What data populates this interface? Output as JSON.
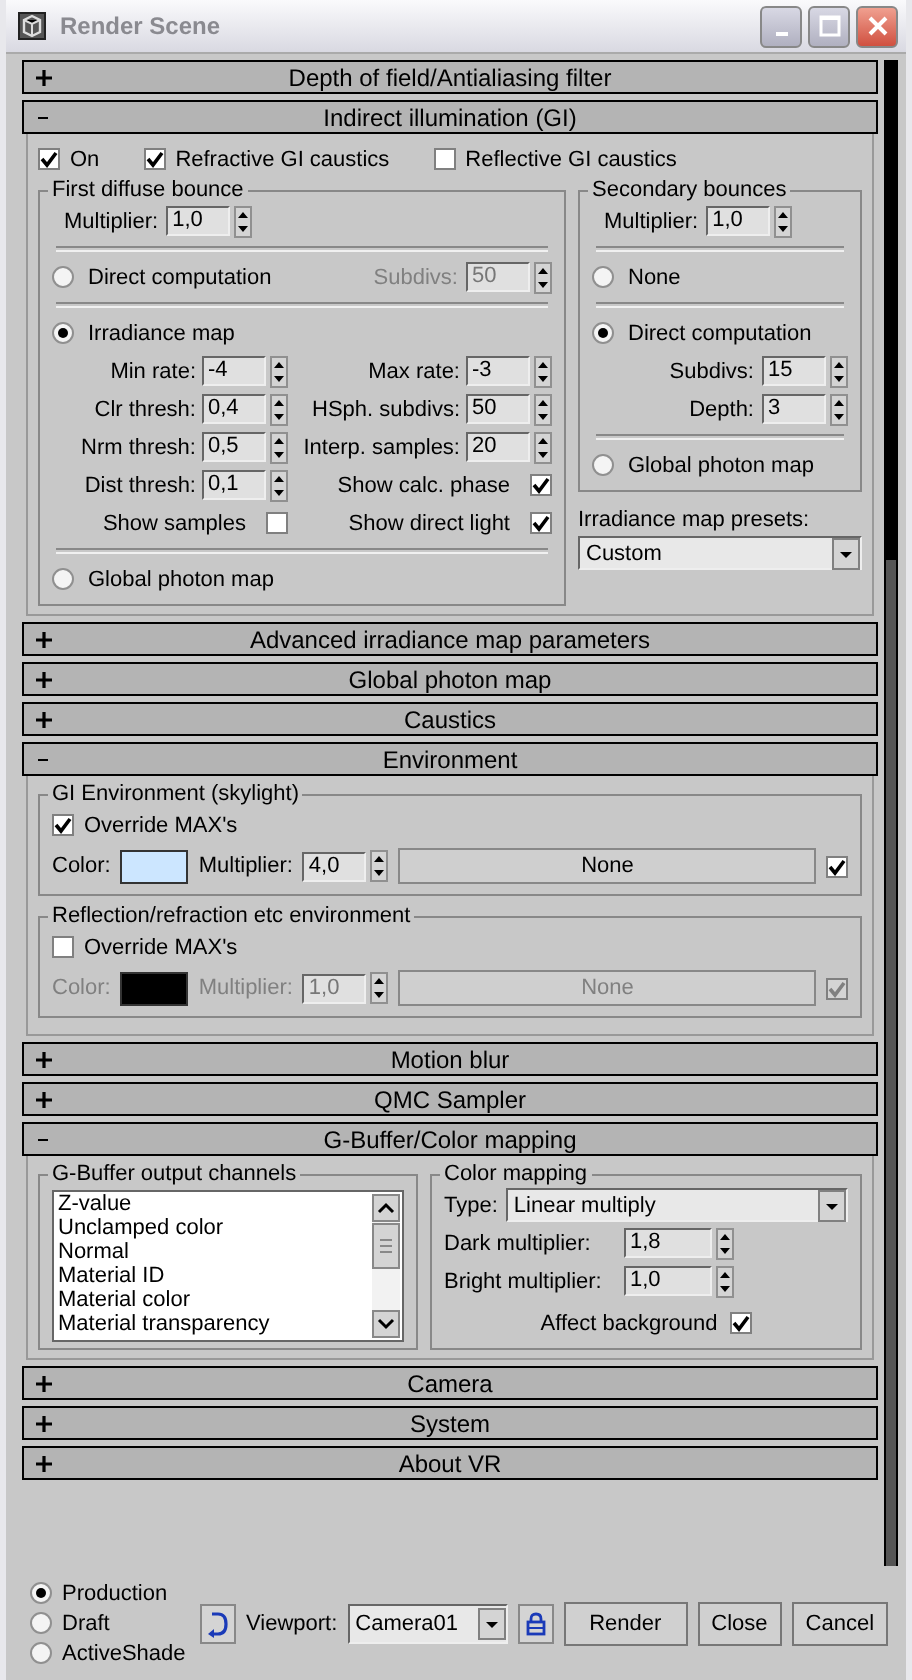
{
  "window": {
    "title": "Render Scene"
  },
  "rollouts": [
    {
      "title": "Depth of field/Antialiasing filter",
      "expanded": false
    },
    {
      "title": "Indirect illumination (GI)",
      "expanded": true,
      "kind": "gi"
    },
    {
      "title": "Advanced irradiance map parameters",
      "expanded": false
    },
    {
      "title": "Global photon map",
      "expanded": false
    },
    {
      "title": "Caustics",
      "expanded": false
    },
    {
      "title": "Environment",
      "expanded": true,
      "kind": "environment"
    },
    {
      "title": "Motion blur",
      "expanded": false
    },
    {
      "title": "QMC Sampler",
      "expanded": false
    },
    {
      "title": "G-Buffer/Color mapping",
      "expanded": true,
      "kind": "gbuffer"
    },
    {
      "title": "Camera",
      "expanded": false
    },
    {
      "title": "System",
      "expanded": false
    },
    {
      "title": "About VR",
      "expanded": false
    }
  ],
  "gi": {
    "checks": [
      {
        "label": "On",
        "checked": true
      },
      {
        "label": "Refractive GI caustics",
        "checked": true
      },
      {
        "label": "Reflective GI caustics",
        "checked": false
      }
    ],
    "first_bounce": {
      "title": "First diffuse bounce",
      "multiplier": {
        "label": "Multiplier:",
        "value": "1,0"
      },
      "engines": [
        {
          "label": "Direct computation",
          "selected": false,
          "subdivs": {
            "label": "Subdivs:",
            "value": "50",
            "disabled": true
          }
        },
        {
          "label": "Irradiance map",
          "selected": true
        },
        {
          "label": "Global photon map",
          "selected": false
        }
      ],
      "params": [
        {
          "kind": "spinner",
          "label": "Min rate:",
          "value": "-4"
        },
        {
          "kind": "spinner",
          "label": "Max rate:",
          "value": "-3"
        },
        {
          "kind": "spinner",
          "label": "Clr thresh:",
          "value": "0,4"
        },
        {
          "kind": "spinner",
          "label": "HSph. subdivs:",
          "value": "50"
        },
        {
          "kind": "spinner",
          "label": "Nrm thresh:",
          "value": "0,5"
        },
        {
          "kind": "spinner",
          "label": "Interp. samples:",
          "value": "20"
        },
        {
          "kind": "spinner",
          "label": "Dist thresh:",
          "value": "0,1"
        },
        {
          "kind": "check",
          "label": "Show calc. phase",
          "checked": true
        },
        {
          "kind": "check",
          "label": "Show samples",
          "checked": false
        },
        {
          "kind": "check",
          "label": "Show direct light",
          "checked": true
        }
      ]
    },
    "secondary": {
      "title": "Secondary bounces",
      "multiplier": {
        "label": "Multiplier:",
        "value": "1,0"
      },
      "engines": [
        {
          "label": "None",
          "selected": false
        },
        {
          "label": "Direct computation",
          "selected": true
        },
        {
          "label": "Global photon map",
          "selected": false
        }
      ],
      "spinners": [
        {
          "label": "Subdivs:",
          "value": "15"
        },
        {
          "label": "Depth:",
          "value": "3"
        }
      ]
    },
    "presets": {
      "label": "Irradiance map presets:",
      "value": "Custom"
    }
  },
  "environment": {
    "groups": [
      {
        "title": "GI Environment (skylight)",
        "disabled": false,
        "override": {
          "label": "Override MAX's",
          "checked": true
        },
        "color_label": "Color:",
        "color": "#cce6ff",
        "multiplier": {
          "label": "Multiplier:",
          "value": "4,0"
        },
        "map": "None",
        "map_on": true
      },
      {
        "title": "Reflection/refraction etc environment",
        "disabled": true,
        "override": {
          "label": "Override MAX's",
          "checked": false
        },
        "color_label": "Color:",
        "color": "#000000",
        "multiplier": {
          "label": "Multiplier:",
          "value": "1,0"
        },
        "map": "None",
        "map_on": true
      }
    ]
  },
  "gbuffer": {
    "channels": {
      "title": "G-Buffer output channels",
      "items": [
        "Z-value",
        "Unclamped color",
        "Normal",
        "Material ID",
        "Material color",
        "Material transparency"
      ]
    },
    "mapping": {
      "title": "Color mapping",
      "type": {
        "label": "Type:",
        "value": "Linear multiply"
      },
      "spinners": [
        {
          "label": "Dark multiplier:",
          "value": "1,8"
        },
        {
          "label": "Bright multiplier:",
          "value": "1,0"
        }
      ],
      "affect": {
        "label": "Affect background",
        "checked": true
      }
    }
  },
  "footer": {
    "modes": [
      {
        "label": "Production",
        "selected": true
      },
      {
        "label": "Draft",
        "selected": false
      },
      {
        "label": "ActiveShade",
        "selected": false
      }
    ],
    "viewport": {
      "label": "Viewport:",
      "value": "Camera01"
    },
    "buttons": [
      "Render",
      "Close",
      "Cancel"
    ]
  }
}
